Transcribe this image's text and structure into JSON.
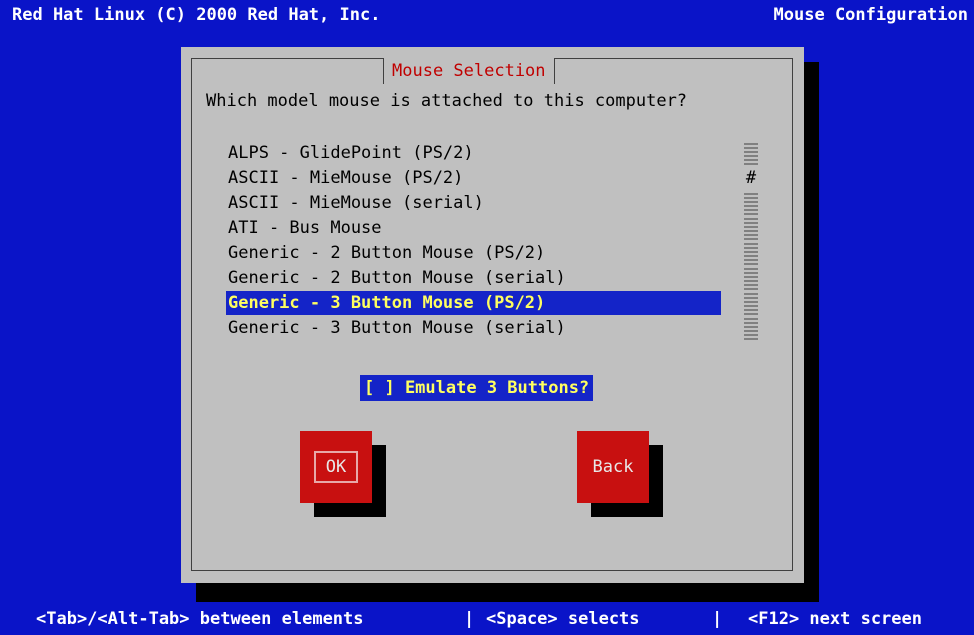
{
  "top_bar": {
    "left": "Red Hat Linux (C) 2000 Red Hat, Inc.",
    "right": "Mouse Configuration"
  },
  "dialog": {
    "title": "Mouse Selection",
    "question": "Which model mouse is attached to this computer?",
    "mouse_list": {
      "items": [
        "ALPS - GlidePoint (PS/2)",
        "ASCII - MieMouse (PS/2)",
        "ASCII - MieMouse (serial)",
        "ATI - Bus Mouse",
        "Generic - 2 Button Mouse (PS/2)",
        "Generic - 2 Button Mouse (serial)",
        "Generic - 3 Button Mouse (PS/2)",
        "Generic - 3 Button Mouse (serial)"
      ],
      "selected_index": 6,
      "scroll_thumb_char": "#"
    },
    "emulate_checkbox": {
      "label": "[ ] Emulate 3 Buttons?",
      "checked": false
    },
    "buttons": {
      "ok": "OK",
      "back": "Back"
    }
  },
  "bottom_bar": {
    "hint_1": "<Tab>/<Alt-Tab> between elements",
    "separator": "|",
    "hint_2": "<Space> selects",
    "hint_3": "<F12> next screen"
  },
  "colors": {
    "background": "#0a14c8",
    "dialog": "#c0c0c0",
    "title_text": "#c00000",
    "highlight": "#1424c8",
    "highlight_text": "#ffff60",
    "button": "#c81010"
  }
}
